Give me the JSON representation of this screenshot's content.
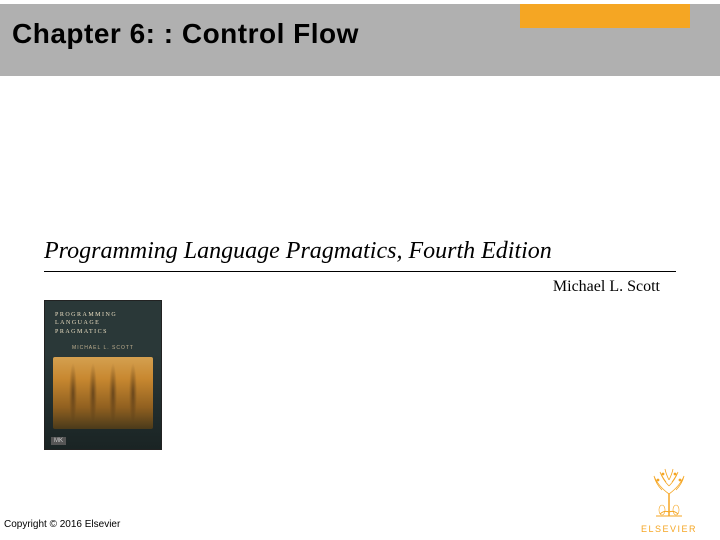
{
  "header": {
    "title": "Chapter 6: : Control Flow"
  },
  "book": {
    "title": "Programming Language Pragmatics, Fourth Edition",
    "author": "Michael L. Scott",
    "cover": {
      "line1": "PROGRAMMING",
      "line2": "LANGUAGE",
      "line3": "PRAGMATICS",
      "cover_author": "MICHAEL L. SCOTT",
      "publisher_mark": "MK"
    }
  },
  "footer": {
    "copyright": "Copyright © 2016 Elsevier",
    "publisher": "ELSEVIER"
  },
  "colors": {
    "accent": "#f5a623",
    "header_band": "#b0b0b0"
  }
}
